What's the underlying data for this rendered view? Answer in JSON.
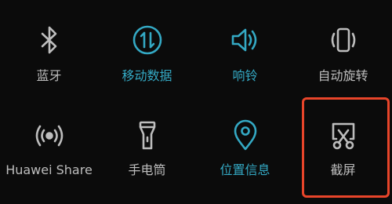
{
  "colors": {
    "background": "#0b0b0b",
    "inactive": "#bdbdbd",
    "active": "#34a9c4",
    "highlight": "#e8452a"
  },
  "tiles": [
    {
      "label": "蓝牙",
      "icon": "bluetooth-icon",
      "active": false
    },
    {
      "label": "移动数据",
      "icon": "mobile-data-icon",
      "active": true
    },
    {
      "label": "响铃",
      "icon": "speaker-icon",
      "active": true
    },
    {
      "label": "自动旋转",
      "icon": "auto-rotate-icon",
      "active": false
    },
    {
      "label": "Huawei Share",
      "icon": "huawei-share-icon",
      "active": false
    },
    {
      "label": "手电筒",
      "icon": "flashlight-icon",
      "active": false
    },
    {
      "label": "位置信息",
      "icon": "location-pin-icon",
      "active": true
    },
    {
      "label": "截屏",
      "icon": "screenshot-icon",
      "active": false
    }
  ]
}
